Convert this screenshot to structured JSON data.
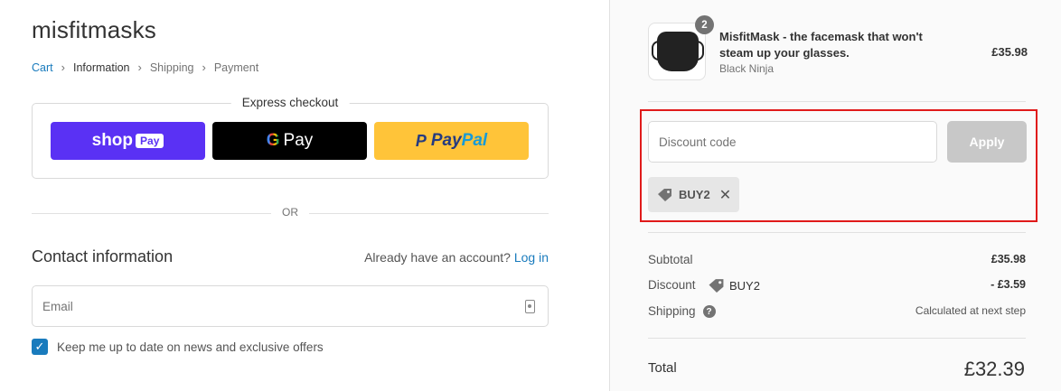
{
  "store": {
    "name": "misfitmasks"
  },
  "breadcrumb": [
    "Cart",
    "Information",
    "Shipping",
    "Payment"
  ],
  "express": {
    "title": "Express checkout",
    "shop_pay": {
      "shop": "shop",
      "pay": "Pay"
    },
    "google_pay": {
      "g": "G",
      "pay": "Pay"
    },
    "paypal": {
      "p1": "Pay",
      "p2": "Pal"
    }
  },
  "or_label": "OR",
  "contact": {
    "title": "Contact information",
    "account_prompt": "Already have an account?",
    "login_label": "Log in",
    "email_placeholder": "Email",
    "newsletter_label": "Keep me up to date on news and exclusive offers",
    "newsletter_checked": true
  },
  "cart": {
    "items": [
      {
        "name": "MisfitMask - the facemask that won't steam up your glasses.",
        "variant": "Black Ninja",
        "price": "£35.98",
        "quantity": "2"
      }
    ]
  },
  "discount": {
    "placeholder": "Discount code",
    "apply_label": "Apply",
    "applied_code": "BUY2"
  },
  "summary": {
    "subtotal_label": "Subtotal",
    "subtotal_value": "£35.98",
    "discount_label": "Discount",
    "discount_code": "BUY2",
    "discount_value": "- £3.59",
    "shipping_label": "Shipping",
    "shipping_value": "Calculated at next step",
    "total_label": "Total",
    "total_value": "£32.39"
  },
  "colors": {
    "accent": "#197bbd",
    "shop_pay": "#5a31f4",
    "paypal": "#ffc439",
    "highlight": "#e01a1a"
  }
}
